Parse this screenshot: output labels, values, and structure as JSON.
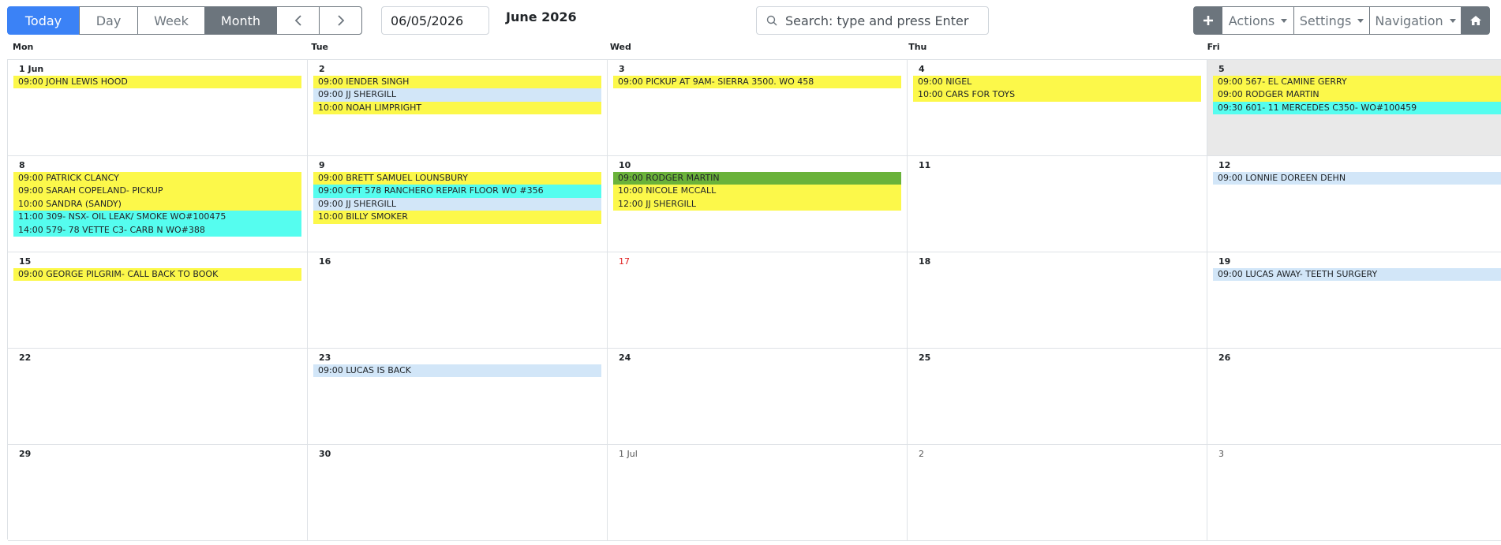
{
  "toolbar": {
    "view_buttons": [
      "Today",
      "Day",
      "Week",
      "Month"
    ],
    "prev_icon": "chevron-left-icon",
    "next_icon": "chevron-right-icon",
    "date_value": "06/05/2026",
    "month_title": "June 2026",
    "search_placeholder": "Search: type and press Enter",
    "add_icon": "plus-icon",
    "actions_label": "Actions",
    "settings_label": "Settings",
    "navigation_label": "Navigation",
    "home_icon": "home-icon"
  },
  "colors": {
    "primary": "#3b82f6",
    "secondary": "#6c757d",
    "yellow_event": "#fcf84a",
    "blue_event": "#d2e6f8",
    "cyan_event": "#55fdef",
    "green_event": "#6ab23a",
    "today_bg": "#e9e9e9",
    "weekend_red": "#e02020"
  },
  "days_of_week": [
    "Mon",
    "Tue",
    "Wed",
    "Thu",
    "Fri"
  ],
  "weeks": [
    [
      {
        "label": "1 Jun",
        "events": [
          {
            "text": "09:00 JOHN LEWIS HOOD",
            "color": "yellow"
          }
        ]
      },
      {
        "label": "2",
        "events": [
          {
            "text": "09:00 IENDER SINGH",
            "color": "yellow"
          },
          {
            "text": "09:00 JJ SHERGILL",
            "color": "blue"
          },
          {
            "text": "10:00 NOAH LIMPRIGHT",
            "color": "yellow"
          }
        ]
      },
      {
        "label": "3",
        "events": [
          {
            "text": "09:00 PICKUP AT 9AM- SIERRA 3500. WO 458",
            "color": "yellow"
          }
        ]
      },
      {
        "label": "4",
        "events": [
          {
            "text": "09:00 NIGEL",
            "color": "yellow"
          },
          {
            "text": "10:00 CARS FOR TOYS",
            "color": "yellow"
          }
        ]
      },
      {
        "label": "5",
        "today": true,
        "events": [
          {
            "text": "09:00 567- EL CAMINE GERRY",
            "color": "yellow"
          },
          {
            "text": "09:00 RODGER MARTIN",
            "color": "yellow"
          },
          {
            "text": "09:30 601- 11 MERCEDES C350- WO#100459",
            "color": "cyan"
          }
        ]
      }
    ],
    [
      {
        "label": "8",
        "events": [
          {
            "text": "09:00 PATRICK CLANCY",
            "color": "yellow"
          },
          {
            "text": "09:00 SARAH COPELAND- PICKUP",
            "color": "yellow"
          },
          {
            "text": "10:00 SANDRA (SANDY)",
            "color": "yellow"
          },
          {
            "text": "11:00 309- NSX- OIL LEAK/ SMOKE WO#100475",
            "color": "cyan"
          },
          {
            "text": "14:00 579- 78 VETTE C3- CARB N WO#388",
            "color": "cyan"
          }
        ]
      },
      {
        "label": "9",
        "events": [
          {
            "text": "09:00 BRETT SAMUEL LOUNSBURY",
            "color": "yellow"
          },
          {
            "text": "09:00 CFT 578 RANCHERO REPAIR FLOOR WO #356",
            "color": "cyan"
          },
          {
            "text": "09:00 JJ SHERGILL",
            "color": "blue"
          },
          {
            "text": "10:00 BILLY SMOKER",
            "color": "yellow"
          }
        ]
      },
      {
        "label": "10",
        "events": [
          {
            "text": "09:00 RODGER MARTIN",
            "color": "green"
          },
          {
            "text": "10:00 NICOLE MCCALL",
            "color": "yellow"
          },
          {
            "text": "12:00 JJ SHERGILL",
            "color": "yellow"
          }
        ]
      },
      {
        "label": "11",
        "events": []
      },
      {
        "label": "12",
        "events": [
          {
            "text": "09:00 LONNIE DOREEN DEHN",
            "color": "blue"
          }
        ]
      }
    ],
    [
      {
        "label": "15",
        "events": [
          {
            "text": "09:00 GEORGE PILGRIM- CALL BACK TO BOOK",
            "color": "yellow"
          }
        ]
      },
      {
        "label": "16",
        "events": []
      },
      {
        "label": "17",
        "red": true,
        "events": []
      },
      {
        "label": "18",
        "events": []
      },
      {
        "label": "19",
        "events": [
          {
            "text": "09:00 LUCAS AWAY- TEETH SURGERY",
            "color": "blue"
          }
        ]
      }
    ],
    [
      {
        "label": "22",
        "events": []
      },
      {
        "label": "23",
        "events": [
          {
            "text": "09:00 LUCAS IS BACK",
            "color": "blue"
          }
        ]
      },
      {
        "label": "24",
        "events": []
      },
      {
        "label": "25",
        "events": []
      },
      {
        "label": "26",
        "events": []
      }
    ],
    [
      {
        "label": "29",
        "events": []
      },
      {
        "label": "30",
        "events": []
      },
      {
        "label": "1 Jul",
        "other": true,
        "events": []
      },
      {
        "label": "2",
        "other": true,
        "events": []
      },
      {
        "label": "3",
        "other": true,
        "events": []
      }
    ]
  ]
}
